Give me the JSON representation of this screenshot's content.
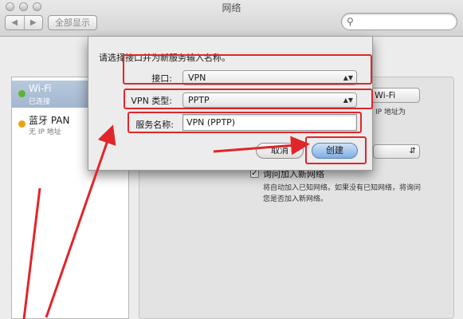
{
  "window": {
    "title": "网络",
    "nav_back_glyph": "◀",
    "nav_forward_glyph": "▶",
    "show_all_label": "全部显示",
    "search_placeholder": ""
  },
  "sidebar": {
    "items": [
      {
        "name": "Wi-Fi",
        "status": "已连接",
        "dot_color": "#5cb531",
        "selected": true
      },
      {
        "name": "蓝牙 PAN",
        "status": "无 IP 地址",
        "dot_color": "#e8a415",
        "selected": false
      }
    ]
  },
  "panel": {
    "wifi_button_label": "Wi-Fi",
    "ip_note": "IP 地址为",
    "ask_join_label": "询问加入新网络",
    "ask_join_checked": true,
    "ask_join_description": "将自动加入已知网络。如果没有已知网络，将询问您是否加入新网络。"
  },
  "sheet": {
    "prompt": "请选择接口并为新服务输入名称。",
    "interface_label": "接口:",
    "interface_value": "VPN",
    "vpn_type_label": "VPN 类型:",
    "vpn_type_value": "PPTP",
    "service_name_label": "服务名称:",
    "service_name_value": "VPN (PPTP)",
    "cancel_label": "取消",
    "create_label": "创建"
  },
  "icons": {
    "search": "magnifier-icon",
    "popup_arrows": "updown-arrows-icon"
  },
  "colors": {
    "annotation_red": "#e0262a",
    "selection_blue": "#a8bbd3",
    "default_button_blue": "#7eaee3"
  }
}
